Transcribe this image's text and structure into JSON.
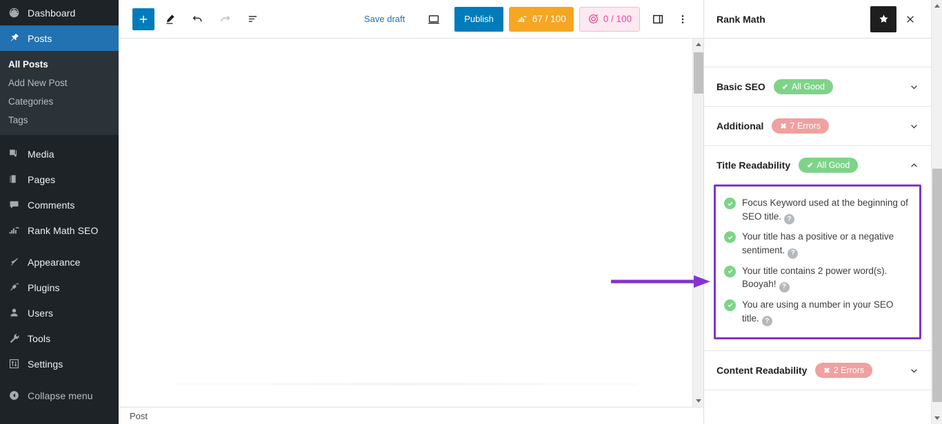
{
  "colors": {
    "wp_admin_bg": "#1d2327",
    "wp_submenu_bg": "#2c3338",
    "wp_current_blue": "#2271b1",
    "editor_blue": "#007cba",
    "seo_score_orange": "#f5a623",
    "content_ai_pink": "#ec4899",
    "content_ai_bg": "#fde9f1",
    "pill_good_green": "#7ed389",
    "pill_error_salmon": "#f0a0a0",
    "annotation_purple": "#8234cd"
  },
  "sidebar": {
    "items": [
      {
        "label": "Dashboard",
        "icon": "dashboard-icon",
        "current": false
      },
      {
        "label": "Posts",
        "icon": "pin-icon",
        "current": true
      },
      {
        "label": "Media",
        "icon": "media-icon",
        "current": false
      },
      {
        "label": "Pages",
        "icon": "pages-icon",
        "current": false
      },
      {
        "label": "Comments",
        "icon": "comments-icon",
        "current": false
      },
      {
        "label": "Rank Math SEO",
        "icon": "rank-math-icon",
        "current": false
      },
      {
        "label": "Appearance",
        "icon": "appearance-brush-icon",
        "current": false
      },
      {
        "label": "Plugins",
        "icon": "plugin-icon",
        "current": false
      },
      {
        "label": "Users",
        "icon": "users-icon",
        "current": false
      },
      {
        "label": "Tools",
        "icon": "wrench-icon",
        "current": false
      },
      {
        "label": "Settings",
        "icon": "settings-sliders-icon",
        "current": false
      },
      {
        "label": "Collapse menu",
        "icon": "collapse-arrow-icon",
        "current": false
      }
    ],
    "submenu": [
      {
        "label": "All Posts",
        "current": true
      },
      {
        "label": "Add New Post",
        "current": false
      },
      {
        "label": "Categories",
        "current": false
      },
      {
        "label": "Tags",
        "current": false
      }
    ]
  },
  "toolbar": {
    "add_block_label": "+",
    "tools": [
      "add-block",
      "edit-pencil",
      "undo",
      "redo",
      "document-overview"
    ],
    "save_draft_label": "Save draft",
    "publish_label": "Publish",
    "seo_score": "67 / 100",
    "content_ai_score": "0 / 100"
  },
  "panel": {
    "title": "Rank Math",
    "sections": [
      {
        "name": "Basic SEO",
        "status_label": "All Good",
        "status_type": "good",
        "expanded": false
      },
      {
        "name": "Additional",
        "status_label": "7 Errors",
        "status_type": "bad",
        "expanded": false
      },
      {
        "name": "Title Readability",
        "status_label": "All Good",
        "status_type": "good",
        "expanded": true
      },
      {
        "name": "Content Readability",
        "status_label": "2 Errors",
        "status_type": "bad",
        "expanded": false
      }
    ],
    "title_readability_checks": [
      {
        "text": "Focus Keyword used at the beginning of SEO title.",
        "state": "good"
      },
      {
        "text": "Your title has a positive or a negative sentiment.",
        "state": "good"
      },
      {
        "text": "Your title contains 2 power word(s). Booyah!",
        "state": "good"
      },
      {
        "text": "You are using a number in your SEO title.",
        "state": "good"
      }
    ],
    "good_mark": "✔",
    "bad_mark": "✖",
    "help_mark": "?"
  },
  "status_bar": {
    "breadcrumb": "Post"
  }
}
